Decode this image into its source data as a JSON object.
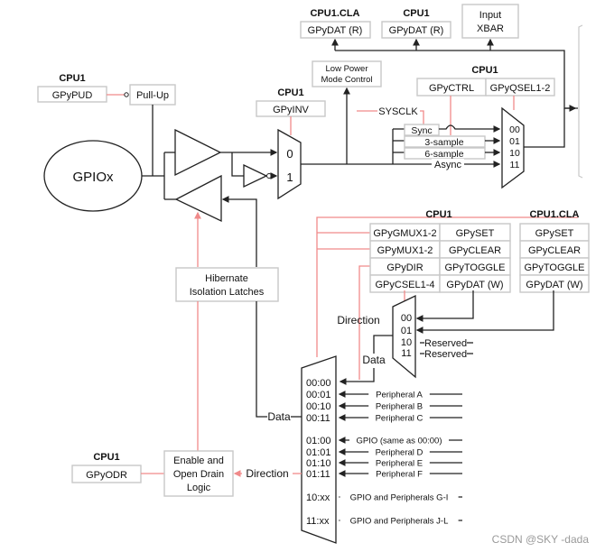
{
  "diagram": {
    "gpio_pad": "GPIOx",
    "pullup": {
      "group": "CPU1",
      "register": "GPyPUD",
      "block": "Pull-Up"
    },
    "inversion": {
      "group": "CPU1",
      "register": "GPyINV",
      "inputs": [
        "0",
        "1"
      ]
    },
    "read_targets": [
      {
        "group": "CPU1.CLA",
        "register": "GPyDAT (R)"
      },
      {
        "group": "CPU1",
        "register": "GPyDAT (R)"
      },
      {
        "group": "",
        "register": "Input XBAR",
        "lines": [
          "Input",
          "XBAR"
        ]
      }
    ],
    "low_power": {
      "lines": [
        "Low Power",
        "Mode Control"
      ]
    },
    "qualification": {
      "group": "CPU1",
      "registers": [
        "GPyCTRL",
        "GPyQSEL1-2"
      ],
      "clock": "SYSCLK",
      "modes": [
        "Sync",
        "3-sample",
        "6-sample",
        "Async"
      ],
      "selects": [
        "00",
        "01",
        "10",
        "11"
      ]
    },
    "cpu1_registers": {
      "group": "CPU1",
      "rows": [
        [
          "GPyGMUX1-2",
          "GPySET"
        ],
        [
          "GPyMUX1-2",
          "GPyCLEAR"
        ],
        [
          "GPyDIR",
          "GPyTOGGLE"
        ],
        [
          "GPyCSEL1-4",
          "GPyDAT (W)"
        ]
      ]
    },
    "cla_registers": {
      "group": "CPU1.CLA",
      "rows": [
        "GPySET",
        "GPyCLEAR",
        "GPyTOGGLE",
        "GPyDAT (W)"
      ]
    },
    "master_select_mux": {
      "labels": [
        "Direction",
        "Data"
      ],
      "selects": [
        "00",
        "01",
        "10",
        "11"
      ],
      "reserved": [
        "Reserved",
        "Reserved"
      ]
    },
    "peripheral_mux": {
      "rows": [
        {
          "sel": "00:00",
          "signal": ""
        },
        {
          "sel": "00:01",
          "signal": "Peripheral A"
        },
        {
          "sel": "00:10",
          "signal": "Peripheral B"
        },
        {
          "sel": "00:11",
          "signal": "Peripheral C"
        },
        {
          "sel": "01:00",
          "signal": "GPIO (same as 00:00)"
        },
        {
          "sel": "01:01",
          "signal": "Peripheral D"
        },
        {
          "sel": "01:10",
          "signal": "Peripheral E"
        },
        {
          "sel": "01:11",
          "signal": "Peripheral F"
        },
        {
          "sel": "10:xx",
          "signal": "GPIO and Peripherals G-I"
        },
        {
          "sel": "11:xx",
          "signal": "GPIO and Peripherals J-L"
        }
      ],
      "data_label": "Data",
      "direction_label": "Direction"
    },
    "hibernate": {
      "lines": [
        "Hibernate",
        "Isolation Latches"
      ]
    },
    "open_drain": {
      "group": "CPU1",
      "register": "GPyODR",
      "lines": [
        "Enable and",
        "Open Drain",
        "Logic"
      ]
    },
    "colors": {
      "wire": "#222222",
      "control_wire": "#f08a8a",
      "box_border": "#c8c8c8"
    }
  },
  "watermark": "CSDN @SKY -dada"
}
